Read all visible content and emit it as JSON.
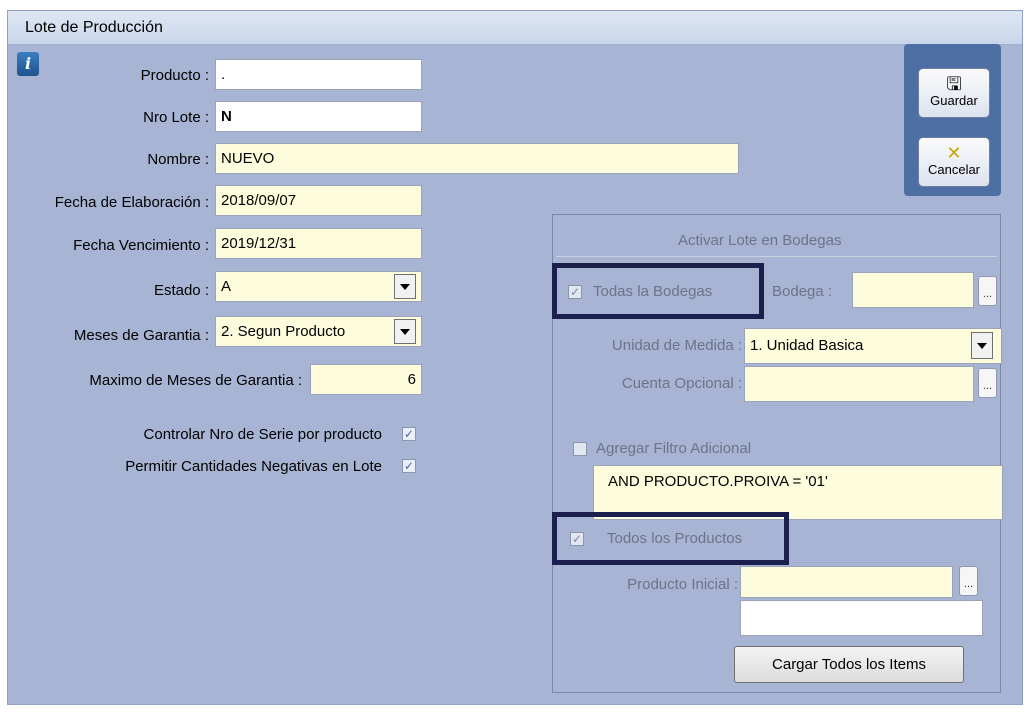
{
  "window": {
    "title": "Lote de Producción"
  },
  "form": {
    "producto": {
      "label": "Producto :",
      "value": "."
    },
    "nro_lote": {
      "label": "Nro Lote :",
      "value": "N"
    },
    "nombre": {
      "label": "Nombre :",
      "value": "NUEVO"
    },
    "fecha_elab": {
      "label": "Fecha de Elaboración :",
      "value": "2018/09/07"
    },
    "fecha_venc": {
      "label": "Fecha Vencimiento :",
      "value": "2019/12/31"
    },
    "estado": {
      "label": "Estado :",
      "value": "A"
    },
    "meses_garantia": {
      "label": "Meses  de  Garantia :",
      "value": "2. Segun Producto"
    },
    "max_meses": {
      "label": "Maximo de Meses  de  Garantia :",
      "value": "6"
    },
    "controlar_serie": {
      "label": "Controlar Nro de Serie por producto",
      "checked": true
    },
    "permitir_negativas": {
      "label": "Permitir Cantidades Negativas en Lote",
      "checked": true
    }
  },
  "toolbar": {
    "guardar": "Guardar",
    "cancelar": "Cancelar"
  },
  "bodegas": {
    "title": "Activar Lote en Bodegas",
    "todas": {
      "label": "Todas la Bodegas",
      "checked": true
    },
    "bodega": {
      "label": "Bodega :",
      "value": ""
    },
    "unidad": {
      "label": "Unidad de Medida :",
      "value": "1. Unidad Basica"
    },
    "cuenta": {
      "label": "Cuenta Opcional :",
      "value": ""
    },
    "filtro": {
      "label": "Agregar Filtro Adicional",
      "checked": false,
      "value": "AND PRODUCTO.PROIVA = '01'"
    },
    "todos_productos": {
      "label": "Todos los Productos",
      "checked": true
    },
    "producto_inicial": {
      "label": "Producto Inicial :",
      "value": "",
      "value2": ""
    },
    "cargar": "Cargar Todos los Items",
    "browse": "..."
  }
}
